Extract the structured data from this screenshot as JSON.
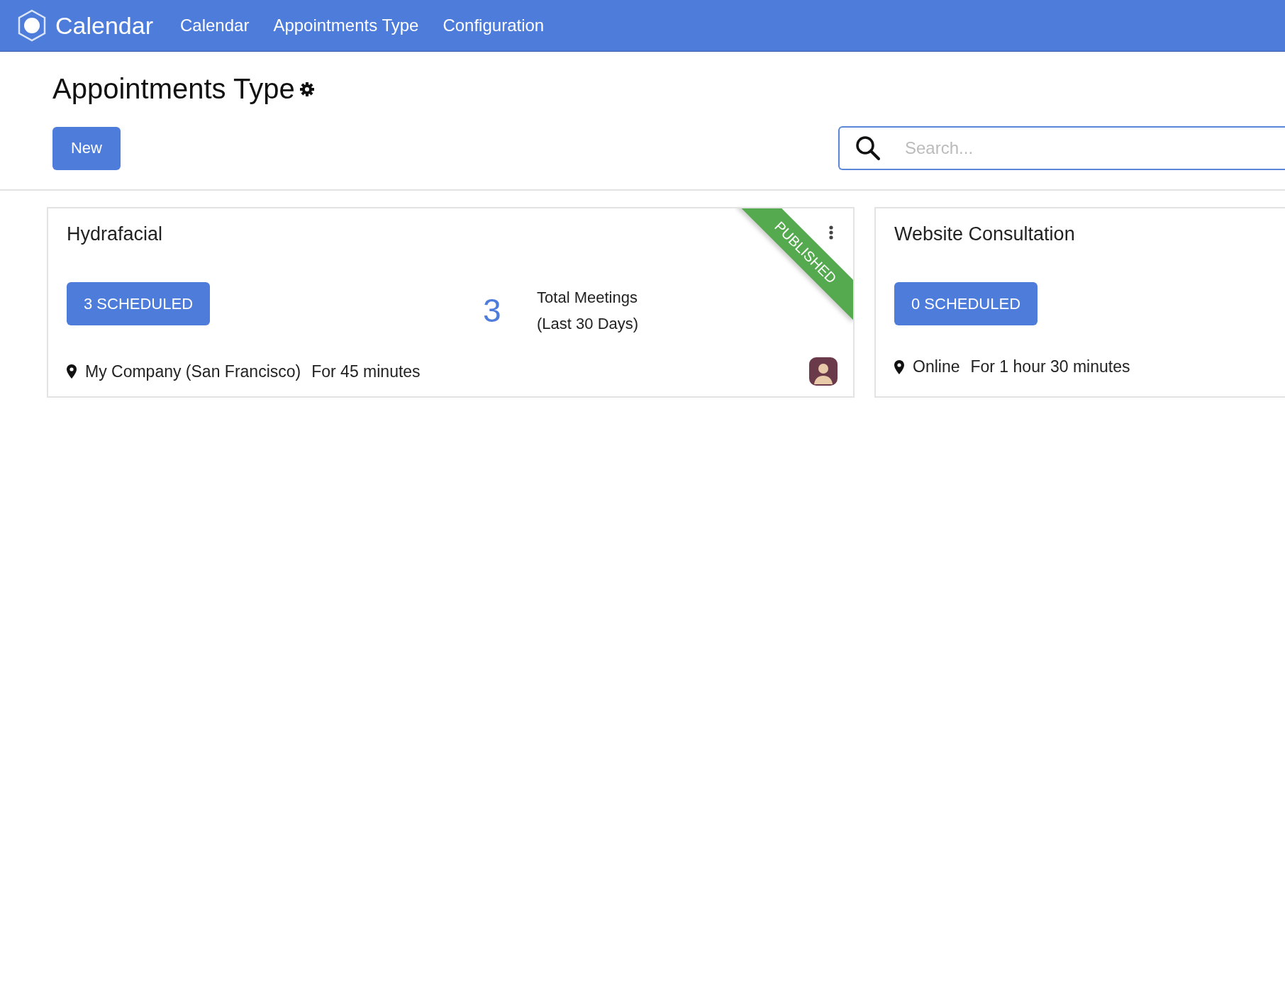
{
  "app": {
    "name": "Calendar"
  },
  "nav": [
    {
      "label": "Calendar"
    },
    {
      "label": "Appointments Type"
    },
    {
      "label": "Configuration"
    }
  ],
  "page": {
    "title": "Appointments Type"
  },
  "toolbar": {
    "new_button": "New",
    "search": {
      "placeholder": "Search..."
    }
  },
  "cards": [
    {
      "title": "Hydrafacial",
      "scheduled": "3 SCHEDULED",
      "ribbon": "PUBLISHED",
      "meetings": {
        "count": "3",
        "label_lines": [
          "Total Meetings",
          "(Last 30 Days)"
        ]
      },
      "location": "My Company (San Francisco)",
      "duration": "For 45 minutes",
      "avatar": true
    },
    {
      "title": "Website Consultation",
      "scheduled": "0 SCHEDULED",
      "location": "Online",
      "duration": "For 1 hour 30 minutes"
    }
  ]
}
